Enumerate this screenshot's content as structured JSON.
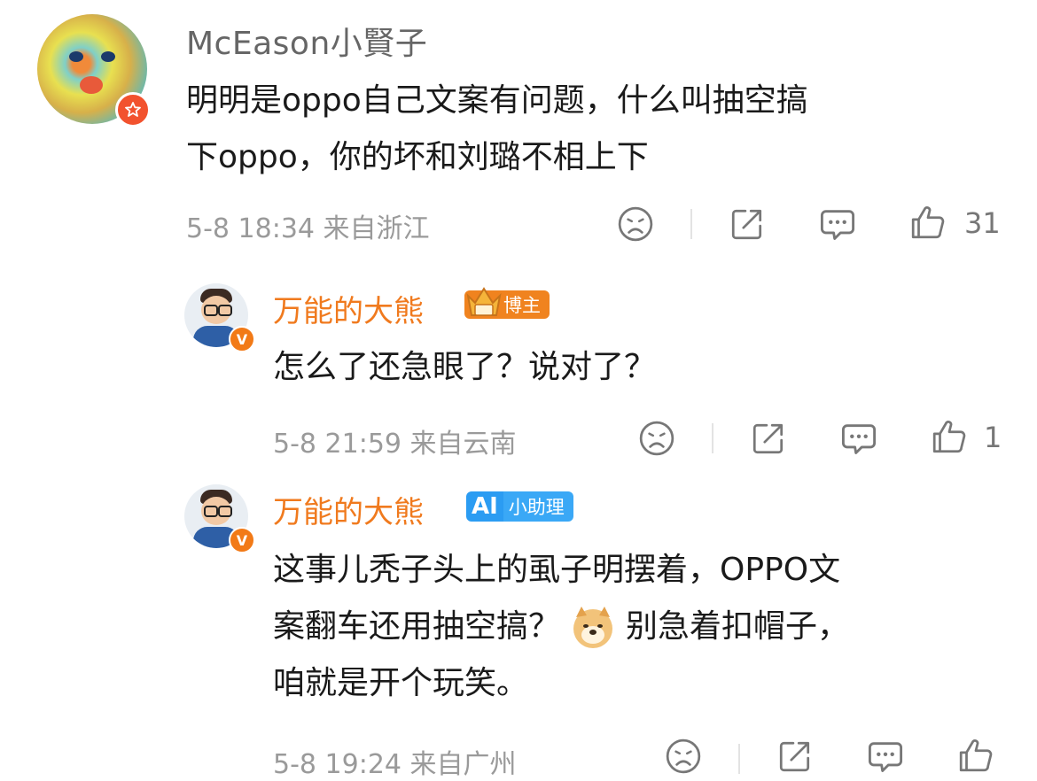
{
  "comments": [
    {
      "username": "McEason小賢子",
      "text_line1": "明明是oppo自己文案有问题，什么叫抽空搞",
      "text_line2": "下oppo，你的坏和刘璐不相上下",
      "meta": "5-8 18:34 来自浙江",
      "like_count": "31"
    },
    {
      "username": "万能的大熊",
      "badge": "博主",
      "text_line1": "怎么了还急眼了？说对了？",
      "meta": "5-8 21:59 来自云南",
      "like_count": "1"
    },
    {
      "username": "万能的大熊",
      "badge_mark": "AI",
      "badge": "小助理",
      "text_line1": "这事儿秃子头上的虱子明摆着，OPPO文",
      "text_line2a": "案翻车还用抽空搞？",
      "text_line2b": "别急着扣帽子，",
      "text_line3": "咱就是开个玩笑。",
      "meta": "5-8 19:24 来自广州"
    }
  ],
  "icons": [
    "dislike-icon",
    "share-icon",
    "comment-icon",
    "like-icon"
  ],
  "colors": {
    "accent": "#f07a1e",
    "ai_blue": "#2b9cf2",
    "meta_gray": "#9a9a9a"
  }
}
